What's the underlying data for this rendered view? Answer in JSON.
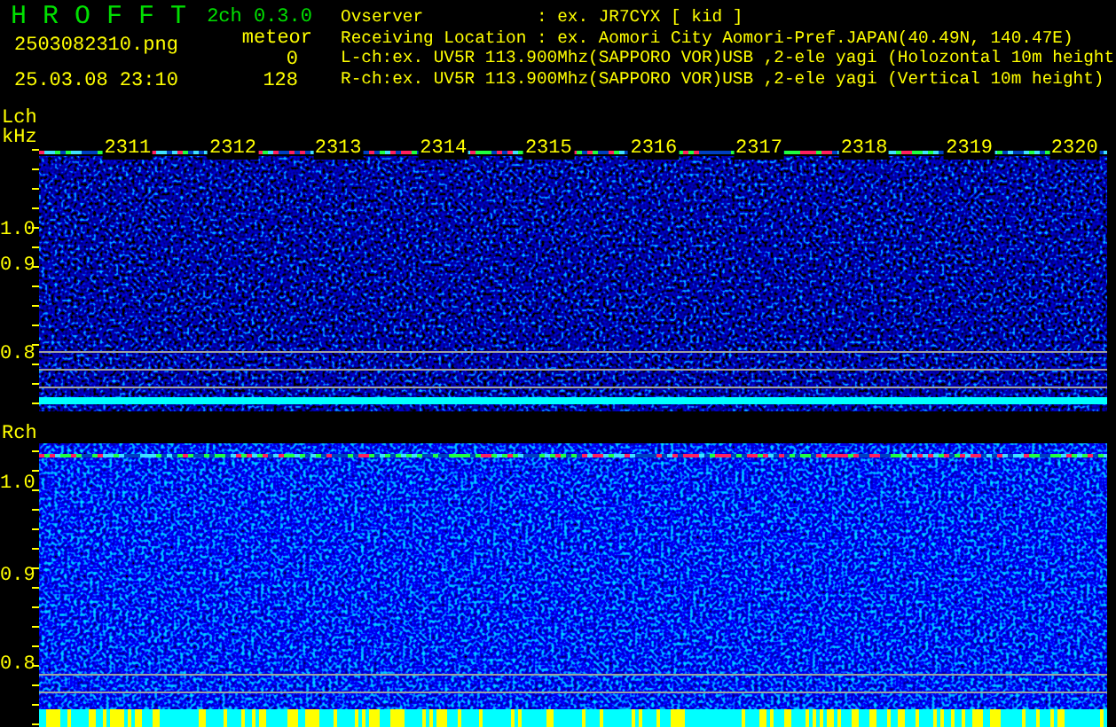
{
  "app": {
    "title": "H R O F F T",
    "version": "2ch 0.3.0",
    "mode": "meteor",
    "filename": "2503082310.png",
    "datetime": "25.03.08 23:10"
  },
  "counts": [
    "0",
    "128"
  ],
  "info": [
    "Ovserver           : ex. JR7CYX [ kid ]",
    "Receiving Location : ex. Aomori City Aomori-Pref.JAPAN(40.49N, 140.47E)",
    "L-ch:ex. UV5R 113.900Mhz(SAPPORO VOR)USB ,2-ele yagi (Holozontal 10m height",
    "R-ch:ex. UV5R 113.900Mhz(SAPPORO VOR)USB ,2-ele yagi (Vertical 10m height)"
  ],
  "panels": [
    {
      "label": "Lch",
      "unit": "kHz",
      "time_labels": [
        "2311",
        "2312",
        "2313",
        "2314",
        "2315",
        "2316",
        "2317",
        "2318",
        "2319",
        "2320"
      ],
      "y_labels": [
        "1.0",
        "0.9",
        "0.8"
      ]
    },
    {
      "label": "Rch",
      "y_labels": [
        "1.0",
        "0.9",
        "0.8"
      ]
    }
  ]
}
